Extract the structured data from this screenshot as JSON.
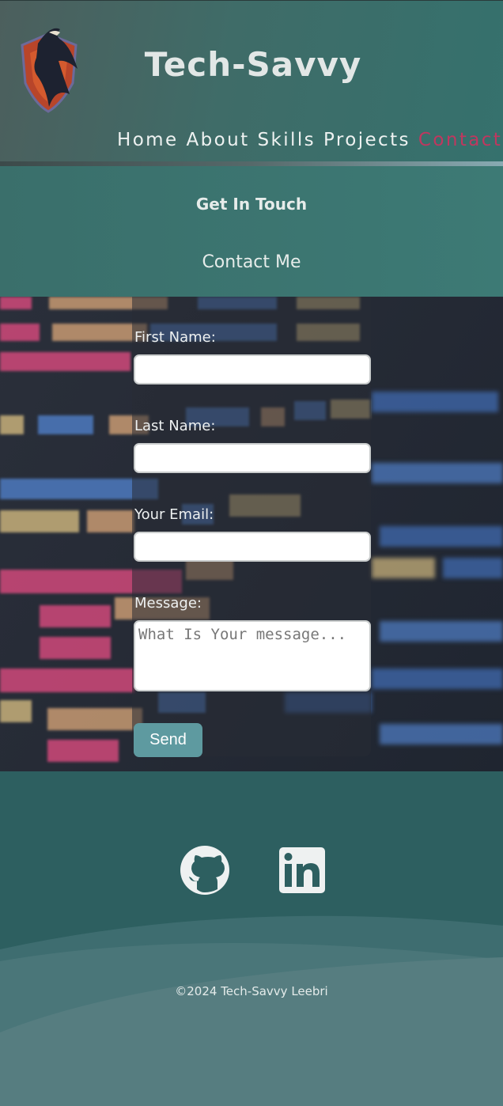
{
  "header": {
    "logo_name": "eagle-shield-logo",
    "site_title": "Tech-Savvy",
    "nav": [
      {
        "label": "Home",
        "active": false
      },
      {
        "label": "About",
        "active": false
      },
      {
        "label": "Skills",
        "active": false
      },
      {
        "label": "Projects",
        "active": false
      },
      {
        "label": "Contact",
        "active": true
      }
    ]
  },
  "intro": {
    "subtitle": "Get In Touch",
    "title": "Contact Me"
  },
  "form": {
    "first_name_label": "First Name:",
    "first_name_value": "",
    "last_name_label": "Last Name:",
    "last_name_value": "",
    "email_label": "Your Email:",
    "email_value": "",
    "message_label": "Message:",
    "message_placeholder": "What Is Your message...",
    "send_label": "Send"
  },
  "footer": {
    "social": [
      {
        "name": "github-icon"
      },
      {
        "name": "linkedin-icon"
      }
    ],
    "copyright": "©2024 Tech-Savvy Leebri"
  },
  "colors": {
    "accent": "#c0375f",
    "button": "#5e9aa0",
    "header_bg": "#3f6c68",
    "footer_bg": "#2d5f60"
  }
}
